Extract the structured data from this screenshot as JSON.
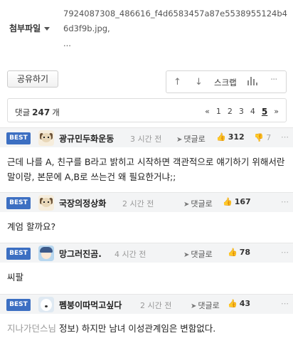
{
  "attachment": {
    "label": "첨부파일",
    "filename": "7924087308_486616_f4d6583457a87e5538955124b46d3f9b.jpg,",
    "more": "..."
  },
  "toolbar": {
    "share_label": "공유하기",
    "scrap_label": "스크랩",
    "up_icon": "↑",
    "down_icon": "↓",
    "more_icon": "···"
  },
  "comment_bar": {
    "label": "댓글",
    "count": "247",
    "unit": "개",
    "pager": {
      "first": "«",
      "pages": [
        "1",
        "2",
        "3",
        "4"
      ],
      "current": "5",
      "next": "»"
    }
  },
  "comments": [
    {
      "badge": "BEST",
      "nickname": "광규민두화운동",
      "time": "3 시간 전",
      "reply_label": "댓글로",
      "likes": "312",
      "dislikes": "7",
      "text": "근데 나를 A, 친구를 B라고 밝히고 시작하면 객관적으로 얘기하기 위해서란 말이랑, 본문에 A,B로 쓰는건 왜 필요한거냐;;"
    },
    {
      "badge": "BEST",
      "nickname": "국장의정상화",
      "time": "2 시간 전",
      "reply_label": "댓글로",
      "likes": "167",
      "text": "계엄 할까요?"
    },
    {
      "badge": "BEST",
      "nickname": "망그러진곰.",
      "time": "4 시간 전",
      "reply_label": "댓글로",
      "likes": "78",
      "text": "씨팔"
    },
    {
      "badge": "BEST",
      "nickname": "펨붕이따먹고싶다",
      "time": "2 시간 전",
      "reply_label": "댓글로",
      "likes": "43",
      "prefix": "지나가던스님",
      "text": "정보) 하지만 남녀 이성관계임은 변함없다."
    }
  ]
}
